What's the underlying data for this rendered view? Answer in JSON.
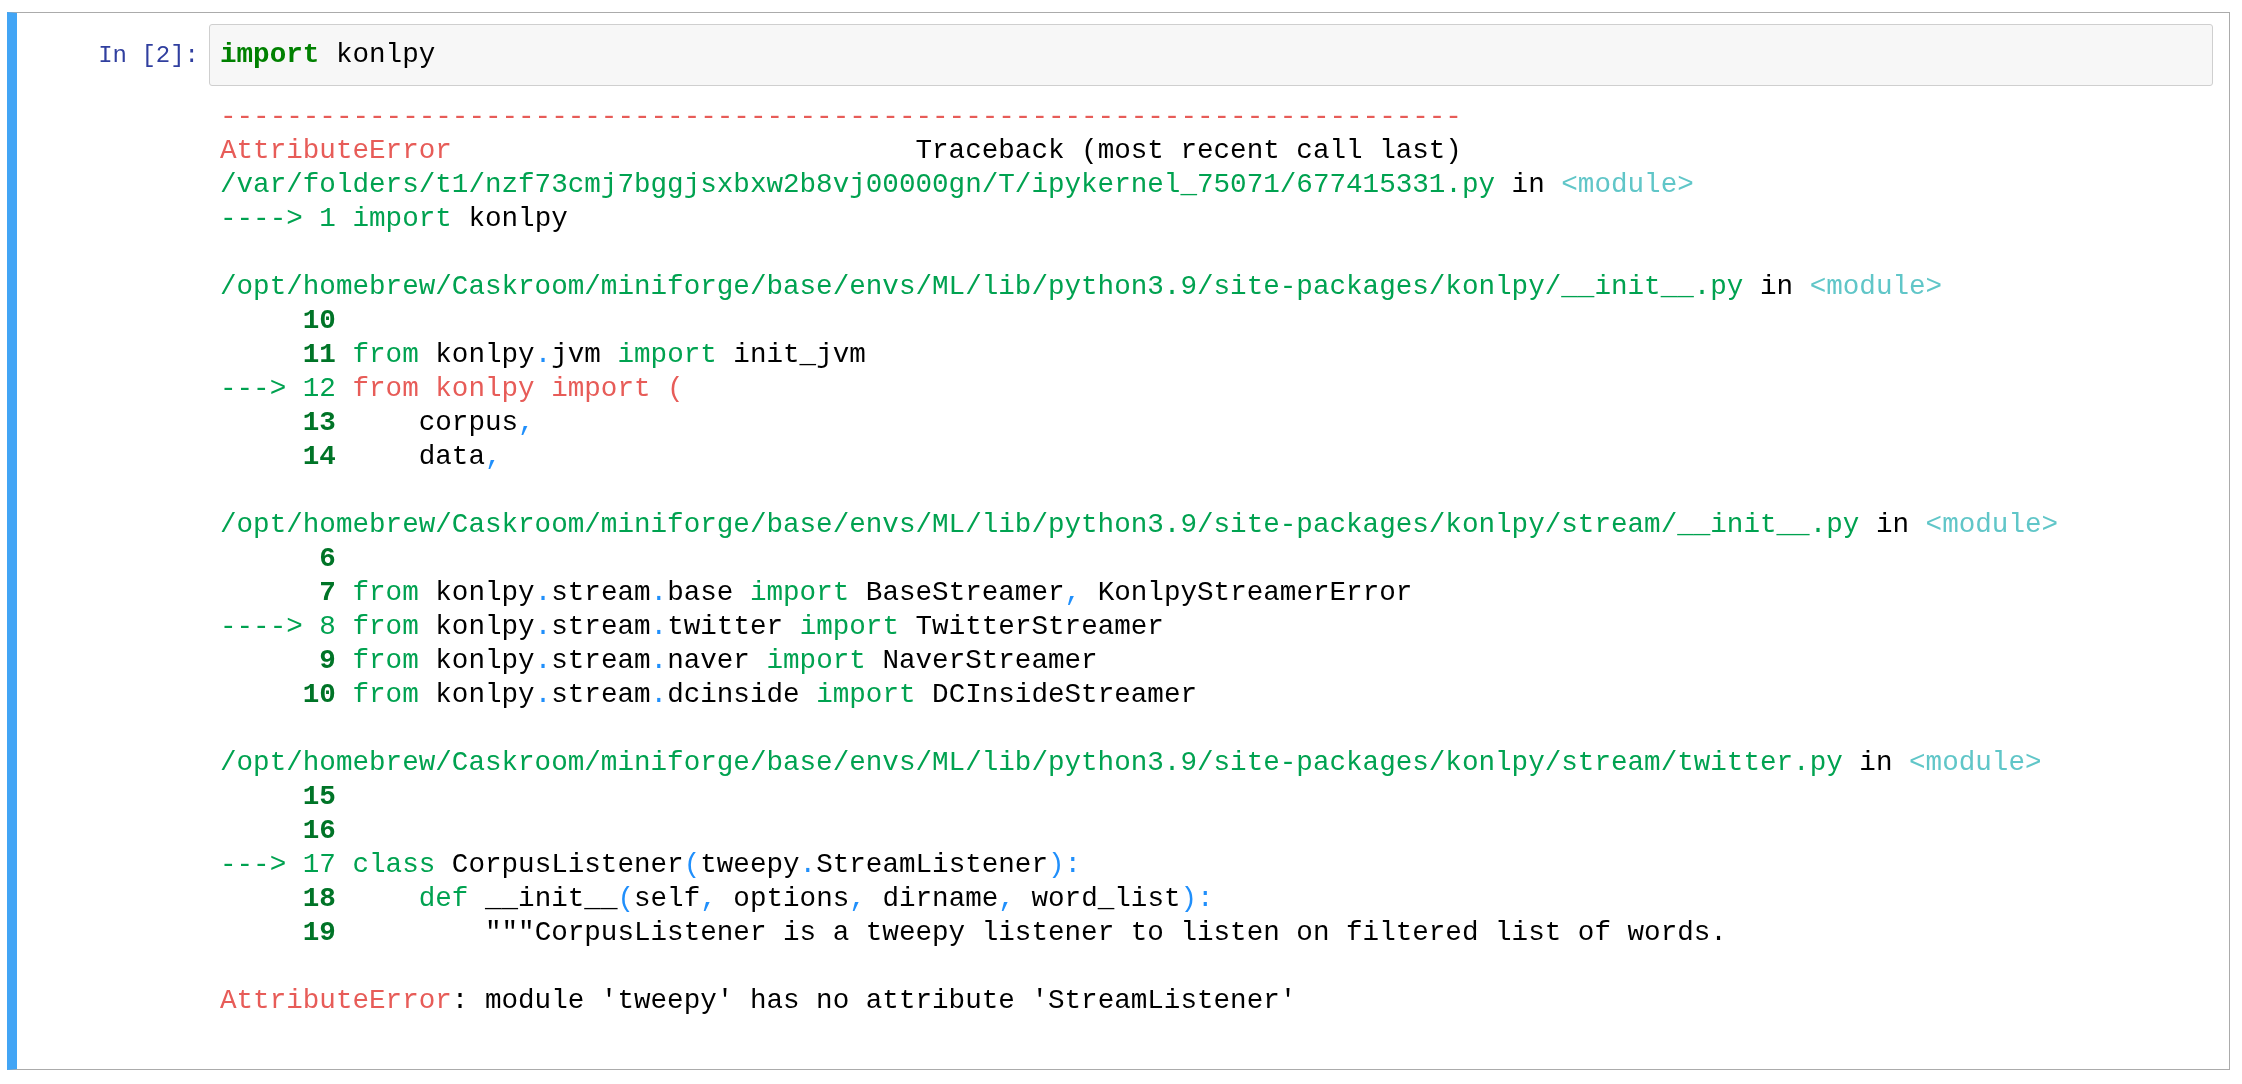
{
  "cell": {
    "selected": true,
    "prompt": "In [2]:",
    "input": [
      {
        "kind": "kw",
        "text": "import"
      },
      {
        "kind": "plain",
        "text": " konlpy"
      }
    ],
    "output_blocks": [
      [
        [
          {
            "kind": "error",
            "text": "---------------------------------------------------------------------------"
          }
        ],
        [
          {
            "kind": "error",
            "text": "AttributeError"
          },
          {
            "kind": "plain",
            "text": "                            Traceback (most recent call last)"
          }
        ],
        [
          {
            "kind": "path",
            "text": "/var/folders/t1/nzf73cmj7bggjsxbxw2b8vj00000gn/T/ipykernel_75071/677415331.py"
          },
          {
            "kind": "plain",
            "text": " in "
          },
          {
            "kind": "module",
            "text": "<module>"
          }
        ],
        [
          {
            "kind": "arrow",
            "text": "----> 1 "
          },
          {
            "kind": "green",
            "text": "import"
          },
          {
            "kind": "plain",
            "text": " konlpy"
          }
        ]
      ],
      [
        [
          {
            "kind": "path",
            "text": "/opt/homebrew/Caskroom/miniforge/base/envs/ML/lib/python3.9/site-packages/konlpy/__init__.py"
          },
          {
            "kind": "plain",
            "text": " in "
          },
          {
            "kind": "module",
            "text": "<module>"
          }
        ],
        [
          {
            "kind": "lineno",
            "text": "     10"
          }
        ],
        [
          {
            "kind": "lineno",
            "text": "     11"
          },
          {
            "kind": "green",
            "text": " from"
          },
          {
            "kind": "plain",
            "text": " konlpy"
          },
          {
            "kind": "punct",
            "text": "."
          },
          {
            "kind": "plain",
            "text": "jvm "
          },
          {
            "kind": "green",
            "text": "import"
          },
          {
            "kind": "plain",
            "text": " init_jvm"
          }
        ],
        [
          {
            "kind": "arrow",
            "text": "---> 12 "
          },
          {
            "kind": "error",
            "text": "from konlpy import ("
          }
        ],
        [
          {
            "kind": "lineno",
            "text": "     13"
          },
          {
            "kind": "plain",
            "text": "     corpus"
          },
          {
            "kind": "punct",
            "text": ","
          }
        ],
        [
          {
            "kind": "lineno",
            "text": "     14"
          },
          {
            "kind": "plain",
            "text": "     data"
          },
          {
            "kind": "punct",
            "text": ","
          }
        ]
      ],
      [
        [
          {
            "kind": "path",
            "text": "/opt/homebrew/Caskroom/miniforge/base/envs/ML/lib/python3.9/site-packages/konlpy/stream/__init__.py"
          },
          {
            "kind": "plain",
            "text": " in "
          },
          {
            "kind": "module",
            "text": "<module>"
          }
        ],
        [
          {
            "kind": "lineno",
            "text": "      6"
          }
        ],
        [
          {
            "kind": "lineno",
            "text": "      7"
          },
          {
            "kind": "green",
            "text": " from"
          },
          {
            "kind": "plain",
            "text": " konlpy"
          },
          {
            "kind": "punct",
            "text": "."
          },
          {
            "kind": "plain",
            "text": "stream"
          },
          {
            "kind": "punct",
            "text": "."
          },
          {
            "kind": "plain",
            "text": "base "
          },
          {
            "kind": "green",
            "text": "import"
          },
          {
            "kind": "plain",
            "text": " BaseStreamer"
          },
          {
            "kind": "punct",
            "text": ","
          },
          {
            "kind": "plain",
            "text": " KonlpyStreamerError"
          }
        ],
        [
          {
            "kind": "arrow",
            "text": "----> 8 "
          },
          {
            "kind": "green",
            "text": "from"
          },
          {
            "kind": "plain",
            "text": " konlpy"
          },
          {
            "kind": "punct",
            "text": "."
          },
          {
            "kind": "plain",
            "text": "stream"
          },
          {
            "kind": "punct",
            "text": "."
          },
          {
            "kind": "plain",
            "text": "twitter "
          },
          {
            "kind": "green",
            "text": "import"
          },
          {
            "kind": "plain",
            "text": " TwitterStreamer"
          }
        ],
        [
          {
            "kind": "lineno",
            "text": "      9"
          },
          {
            "kind": "green",
            "text": " from"
          },
          {
            "kind": "plain",
            "text": " konlpy"
          },
          {
            "kind": "punct",
            "text": "."
          },
          {
            "kind": "plain",
            "text": "stream"
          },
          {
            "kind": "punct",
            "text": "."
          },
          {
            "kind": "plain",
            "text": "naver "
          },
          {
            "kind": "green",
            "text": "import"
          },
          {
            "kind": "plain",
            "text": " NaverStreamer"
          }
        ],
        [
          {
            "kind": "lineno",
            "text": "     10"
          },
          {
            "kind": "green",
            "text": " from"
          },
          {
            "kind": "plain",
            "text": " konlpy"
          },
          {
            "kind": "punct",
            "text": "."
          },
          {
            "kind": "plain",
            "text": "stream"
          },
          {
            "kind": "punct",
            "text": "."
          },
          {
            "kind": "plain",
            "text": "dcinside "
          },
          {
            "kind": "green",
            "text": "import"
          },
          {
            "kind": "plain",
            "text": " DCInsideStreamer"
          }
        ]
      ],
      [
        [
          {
            "kind": "path",
            "text": "/opt/homebrew/Caskroom/miniforge/base/envs/ML/lib/python3.9/site-packages/konlpy/stream/twitter.py"
          },
          {
            "kind": "plain",
            "text": " in "
          },
          {
            "kind": "module",
            "text": "<module>"
          }
        ],
        [
          {
            "kind": "lineno",
            "text": "     15"
          }
        ],
        [
          {
            "kind": "lineno",
            "text": "     16"
          }
        ],
        [
          {
            "kind": "arrow",
            "text": "---> 17 "
          },
          {
            "kind": "green",
            "text": "class"
          },
          {
            "kind": "plain",
            "text": " CorpusListener"
          },
          {
            "kind": "punct",
            "text": "("
          },
          {
            "kind": "plain",
            "text": "tweepy"
          },
          {
            "kind": "punct",
            "text": "."
          },
          {
            "kind": "plain",
            "text": "StreamListener"
          },
          {
            "kind": "punct",
            "text": "):"
          }
        ],
        [
          {
            "kind": "lineno",
            "text": "     18"
          },
          {
            "kind": "green",
            "text": "     def"
          },
          {
            "kind": "plain",
            "text": " __init__"
          },
          {
            "kind": "punct",
            "text": "("
          },
          {
            "kind": "plain",
            "text": "self"
          },
          {
            "kind": "punct",
            "text": ","
          },
          {
            "kind": "plain",
            "text": " options"
          },
          {
            "kind": "punct",
            "text": ","
          },
          {
            "kind": "plain",
            "text": " dirname"
          },
          {
            "kind": "punct",
            "text": ","
          },
          {
            "kind": "plain",
            "text": " word_list"
          },
          {
            "kind": "punct",
            "text": "):"
          }
        ],
        [
          {
            "kind": "lineno",
            "text": "     19"
          },
          {
            "kind": "plain",
            "text": "         \"\"\"CorpusListener is a tweepy listener to listen on filtered list of words."
          }
        ]
      ],
      [
        [
          {
            "kind": "error",
            "text": "AttributeError"
          },
          {
            "kind": "plain",
            "text": ": module 'tweepy' has no attribute 'StreamListener'"
          }
        ]
      ]
    ]
  }
}
